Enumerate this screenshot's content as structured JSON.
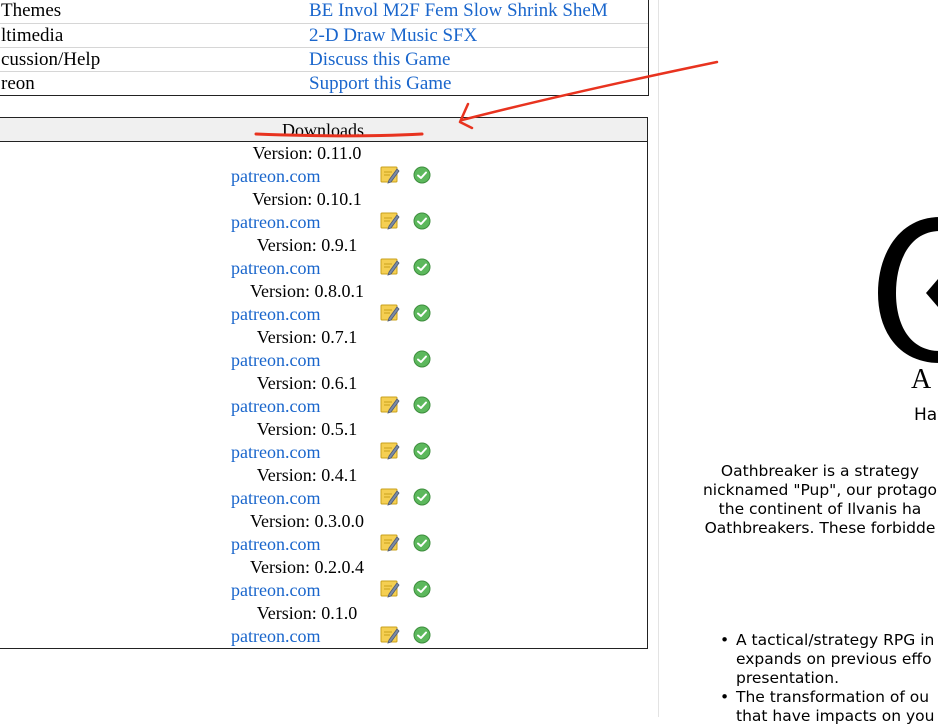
{
  "info_rows": [
    {
      "label": "Themes",
      "value": "BE Invol M2F Fem Slow Shrink SheM"
    },
    {
      "label": "ltimedia",
      "value": "2-D Draw Music SFX"
    },
    {
      "label": "cussion/Help",
      "value": "Discuss this Game"
    },
    {
      "label": "reon",
      "value": "Support this Game"
    }
  ],
  "downloads": {
    "header": "Downloads",
    "items": [
      {
        "version": "Version: 0.11.0",
        "link": "patreon.com",
        "note": true
      },
      {
        "version": "Version: 0.10.1",
        "link": "patreon.com",
        "note": true
      },
      {
        "version": "Version: 0.9.1",
        "link": "patreon.com",
        "note": true
      },
      {
        "version": "Version: 0.8.0.1",
        "link": "patreon.com",
        "note": true
      },
      {
        "version": "Version: 0.7.1",
        "link": "patreon.com",
        "note": false
      },
      {
        "version": "Version: 0.6.1",
        "link": "patreon.com",
        "note": true
      },
      {
        "version": "Version: 0.5.1",
        "link": "patreon.com",
        "note": true
      },
      {
        "version": "Version: 0.4.1",
        "link": "patreon.com",
        "note": true
      },
      {
        "version": "Version: 0.3.0.0",
        "link": "patreon.com",
        "note": true
      },
      {
        "version": "Version: 0.2.0.4",
        "link": "patreon.com",
        "note": true
      },
      {
        "version": "Version: 0.1.0",
        "link": "patreon.com",
        "note": true
      }
    ]
  },
  "logo": {
    "letter": "A",
    "tagline": "Hav"
  },
  "description": [
    "Oathbreaker is a strategy",
    "nicknamed \"Pup\", our protago",
    "the continent of Ilvanis ha",
    "Oathbreakers. These forbidde"
  ],
  "features": [
    {
      "lines": [
        "A tactical/strategy RPG in",
        "expands on previous effo",
        "presentation."
      ]
    },
    {
      "lines": [
        "The transformation of ou",
        "that have impacts on you"
      ]
    }
  ],
  "colors": {
    "link": "#1a66cc",
    "annotation": "#e8331f",
    "check": "#4caf50",
    "note": "#f2c744"
  },
  "icons": {
    "note": "note-edit-icon",
    "check": "check-circle-icon"
  }
}
